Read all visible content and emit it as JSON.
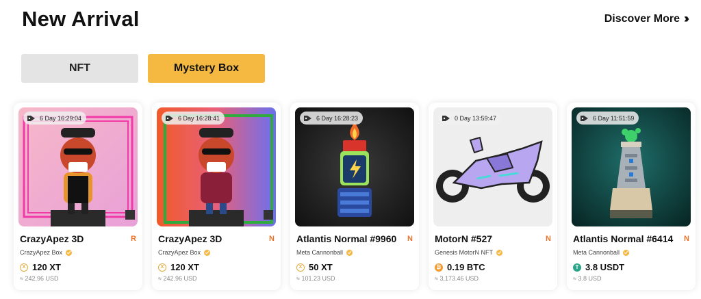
{
  "header": {
    "title": "New Arrival",
    "discover_label": "Discover More",
    "discover_icon": "double-chevron-right-icon"
  },
  "tabs": [
    {
      "label": "NFT",
      "active": false
    },
    {
      "label": "Mystery Box",
      "active": true
    }
  ],
  "colors": {
    "accent": "#f5b941",
    "rarity": "#e8742c",
    "tab_inactive": "#e4e4e4"
  },
  "cards": [
    {
      "timer": "6 Day 16:29:04",
      "title": "CrazyApez 3D",
      "rarity": "R",
      "collection": "CrazyApez Box",
      "price": "120 XT",
      "coin": "xt-coin-icon",
      "usd": "≈ 242.96 USD"
    },
    {
      "timer": "6 Day 16:28:41",
      "title": "CrazyApez 3D",
      "rarity": "N",
      "collection": "CrazyApez Box",
      "price": "120 XT",
      "coin": "xt-coin-icon",
      "usd": "≈ 242.96 USD"
    },
    {
      "timer": "6 Day 16:28:23",
      "title": "Atlantis Normal #9960",
      "rarity": "N",
      "collection": "Meta Cannonball",
      "price": "50 XT",
      "coin": "xt-coin-icon",
      "usd": "≈ 101.23 USD"
    },
    {
      "timer": "0 Day 13:59:47",
      "title": "MotorN #527",
      "rarity": "N",
      "collection": "Genesis MotorN NFT",
      "price": "0.19 BTC",
      "coin": "btc-coin-icon",
      "usd": "≈ 3,173.46 USD"
    },
    {
      "timer": "6 Day 11:51:59",
      "title": "Atlantis Normal #6414",
      "rarity": "N",
      "collection": "Meta Cannonball",
      "price": "3.8 USDT",
      "coin": "usdt-coin-icon",
      "usd": "≈ 3.8 USD"
    }
  ]
}
